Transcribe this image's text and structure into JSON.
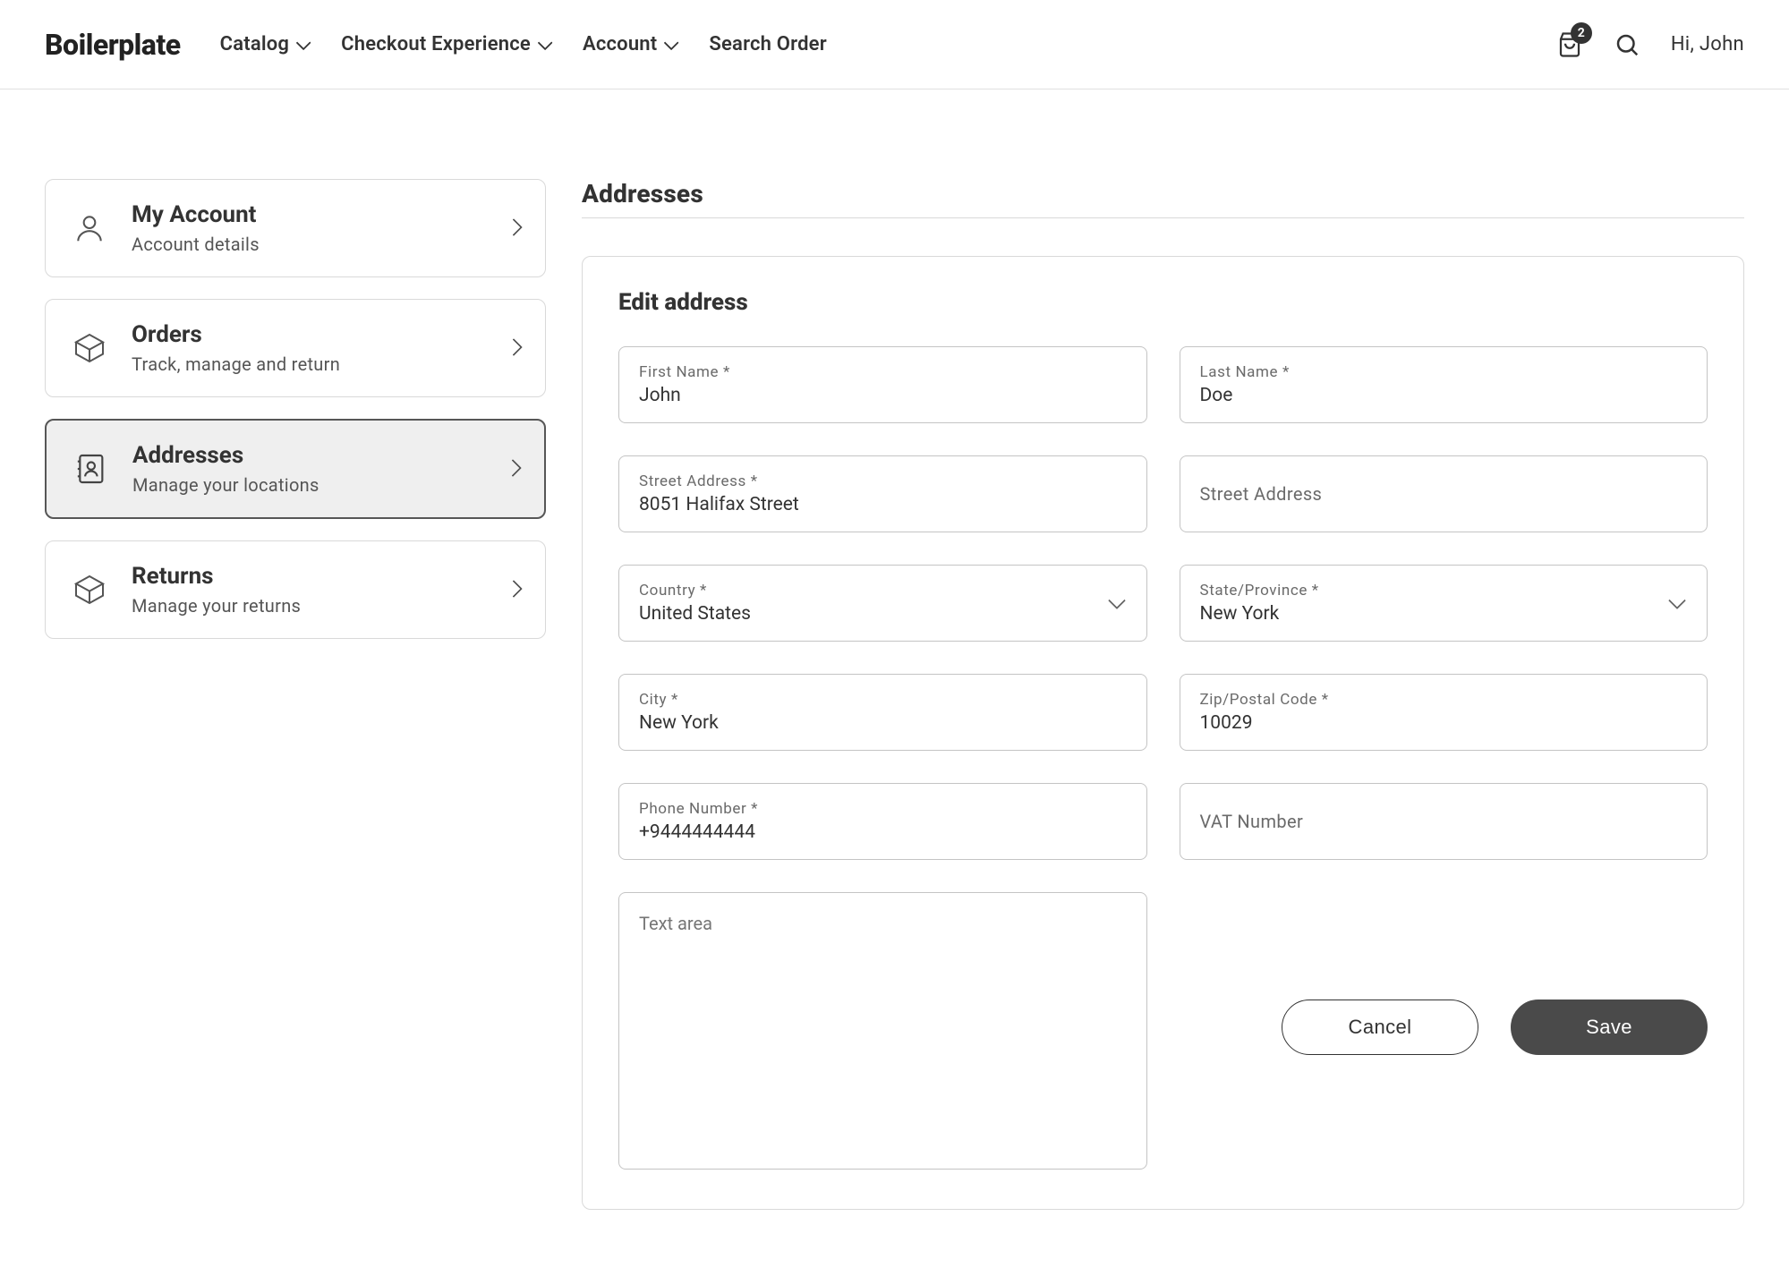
{
  "header": {
    "brand": "Boilerplate",
    "nav": {
      "catalog": "Catalog",
      "checkout": "Checkout Experience",
      "account": "Account",
      "search_order": "Search Order"
    },
    "cart_count": "2",
    "greeting": "Hi, John"
  },
  "sidebar": {
    "my_account": {
      "title": "My Account",
      "sub": "Account details"
    },
    "orders": {
      "title": "Orders",
      "sub": "Track, manage and return"
    },
    "addresses": {
      "title": "Addresses",
      "sub": "Manage your locations"
    },
    "returns": {
      "title": "Returns",
      "sub": "Manage your returns"
    }
  },
  "main": {
    "page_title": "Addresses",
    "panel_title": "Edit address",
    "form": {
      "first_name": {
        "label": "First Name *",
        "value": "John"
      },
      "last_name": {
        "label": "Last Name *",
        "value": "Doe"
      },
      "street1": {
        "label": "Street Address *",
        "value": "8051 Halifax Street"
      },
      "street2": {
        "placeholder": "Street Address"
      },
      "country": {
        "label": "Country *",
        "value": "United States"
      },
      "state": {
        "label": "State/Province *",
        "value": "New York"
      },
      "city": {
        "label": "City *",
        "value": "New York"
      },
      "zip": {
        "label": "Zip/Postal Code *",
        "value": "10029"
      },
      "phone": {
        "label": "Phone Number *",
        "value": "+9444444444"
      },
      "vat": {
        "placeholder": "VAT Number"
      },
      "textarea_placeholder": "Text area"
    },
    "buttons": {
      "cancel": "Cancel",
      "save": "Save"
    }
  }
}
